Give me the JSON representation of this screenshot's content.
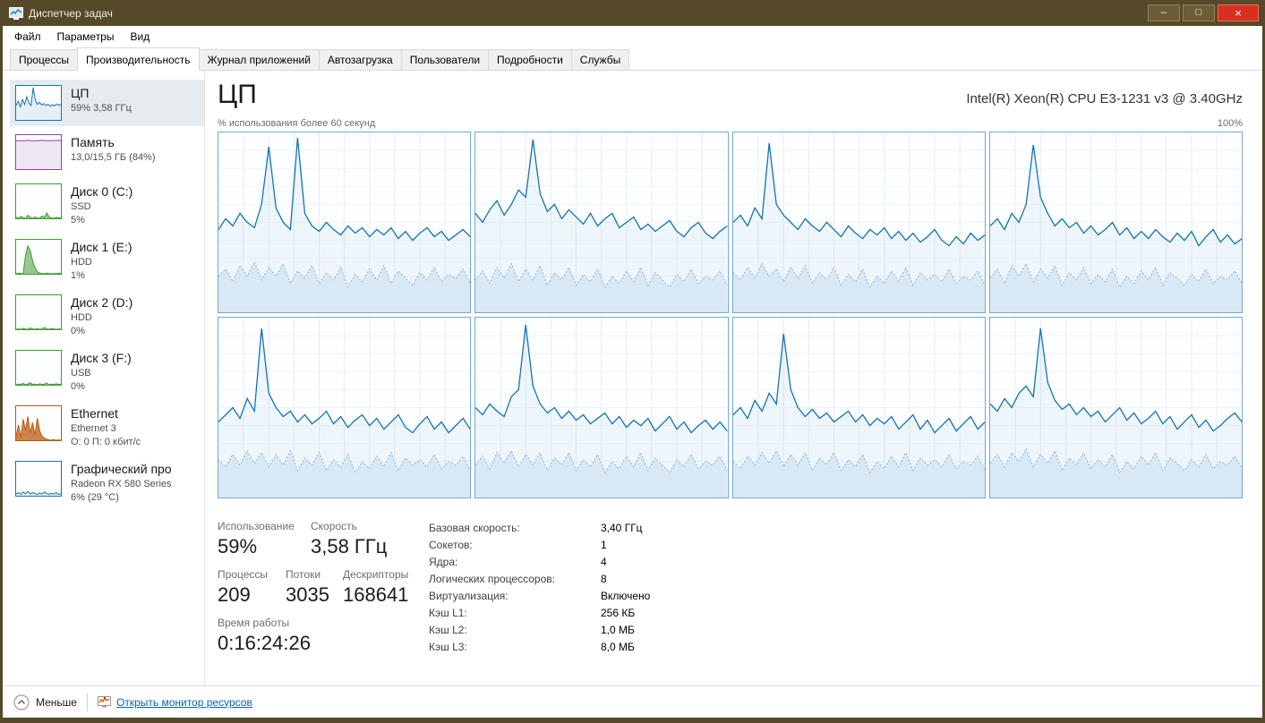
{
  "window": {
    "title": "Диспетчер задач",
    "controls": {
      "minimize": "–",
      "maximize": "□",
      "close": "×"
    }
  },
  "menu": {
    "items": [
      {
        "label": "Файл"
      },
      {
        "label": "Параметры"
      },
      {
        "label": "Вид"
      }
    ]
  },
  "tabs": [
    {
      "label": "Процессы"
    },
    {
      "label": "Производительность"
    },
    {
      "label": "Журнал приложений"
    },
    {
      "label": "Автозагрузка"
    },
    {
      "label": "Пользователи"
    },
    {
      "label": "Подробности"
    },
    {
      "label": "Службы"
    }
  ],
  "sidebar": {
    "items": [
      {
        "title": "ЦП",
        "lines": [
          "59%  3,58 ГГц"
        ],
        "color": "#1273b4",
        "fill": "rgba(18,115,180,0.10)",
        "series": [
          42,
          55,
          38,
          60,
          45,
          68,
          50,
          42,
          95,
          58,
          46,
          52,
          44,
          48,
          42,
          46,
          40,
          45,
          41,
          47,
          43,
          46
        ]
      },
      {
        "title": "Память",
        "lines": [
          "13,0/15,5 ГБ (84%)"
        ],
        "color": "#9341b3",
        "fill": "rgba(147,65,179,0.12)",
        "series": [
          83,
          84,
          84,
          83,
          84,
          85,
          84,
          84,
          83,
          84,
          84,
          85,
          84,
          84,
          83,
          84,
          84,
          84,
          85,
          84
        ]
      },
      {
        "title": "Диск 0 (C:)",
        "lines": [
          "SSD",
          "5%"
        ],
        "color": "#3f9c35",
        "fill": "rgba(63,156,53,0.55)",
        "series": [
          3,
          0,
          6,
          2,
          0,
          9,
          3,
          0,
          4,
          1,
          0,
          7,
          2,
          16,
          4,
          1,
          0,
          3,
          1,
          2
        ]
      },
      {
        "title": "Диск 1 (E:)",
        "lines": [
          "HDD",
          "1%"
        ],
        "color": "#3f9c35",
        "fill": "rgba(63,156,53,0.55)",
        "series": [
          0,
          2,
          1,
          0,
          55,
          82,
          68,
          38,
          18,
          6,
          2,
          1,
          0,
          2,
          1,
          0,
          1,
          0,
          2,
          1
        ]
      },
      {
        "title": "Диск 2 (D:)",
        "lines": [
          "HDD",
          "0%"
        ],
        "color": "#3f9c35",
        "fill": "rgba(63,156,53,0.55)",
        "series": [
          0,
          1,
          0,
          3,
          1,
          0,
          4,
          1,
          0,
          2,
          0,
          1,
          5,
          1,
          0,
          2,
          1,
          0,
          1,
          0
        ]
      },
      {
        "title": "Диск 3 (F:)",
        "lines": [
          "USB",
          "0%"
        ],
        "color": "#3f9c35",
        "fill": "rgba(63,156,53,0.55)",
        "series": [
          0,
          2,
          1,
          4,
          0,
          2,
          6,
          1,
          2,
          0,
          3,
          1,
          2,
          5,
          0,
          2,
          1,
          3,
          1,
          2
        ]
      },
      {
        "title": "Ethernet",
        "lines": [
          "Ethernet 3",
          "О: 0 П: 0 кбит/с"
        ],
        "color": "#bc5b12",
        "fill": "rgba(188,91,18,0.75)",
        "series": [
          12,
          45,
          8,
          62,
          30,
          70,
          22,
          52,
          15,
          65,
          28,
          12,
          6,
          3,
          1,
          0,
          2,
          0,
          1,
          0
        ]
      },
      {
        "title": "Графический про",
        "lines": [
          "Radeon RX 580 Series",
          "6%  (29 °C)"
        ],
        "color": "#1273b4",
        "fill": "rgba(18,115,180,0.10)",
        "series": [
          5,
          9,
          4,
          11,
          6,
          13,
          5,
          9,
          6,
          4,
          8,
          5,
          11,
          6,
          4,
          7,
          5,
          9,
          4,
          6
        ]
      }
    ]
  },
  "main": {
    "title": "ЦП",
    "cpu_name": "Intel(R) Xeon(R) CPU E3-1231 v3 @ 3.40GHz",
    "chart_caption": "% использования более 60 секунд",
    "chart_max": "100%",
    "stats_left": {
      "usage_label": "Использование",
      "usage_value": "59%",
      "speed_label": "Скорость",
      "speed_value": "3,58 ГГц",
      "processes_label": "Процессы",
      "processes_value": "209",
      "threads_label": "Потоки",
      "threads_value": "3035",
      "handles_label": "Дескрипторы",
      "handles_value": "168641",
      "uptime_label": "Время работы",
      "uptime_value": "0:16:24:26"
    },
    "stats_right": [
      {
        "label": "Базовая скорость:",
        "value": "3,40 ГГц"
      },
      {
        "label": "Сокетов:",
        "value": "1"
      },
      {
        "label": "Ядра:",
        "value": "4"
      },
      {
        "label": "Логических процессоров:",
        "value": "8"
      },
      {
        "label": "Виртуализация:",
        "value": "Включено"
      },
      {
        "label": "Кэш L1:",
        "value": "256 КБ"
      },
      {
        "label": "Кэш L2:",
        "value": "1,0 МБ"
      },
      {
        "label": "Кэш L3:",
        "value": "8,0 МБ"
      }
    ]
  },
  "footer": {
    "less_label": "Меньше",
    "resmon_label": "Открыть монитор ресурсов"
  },
  "chart_data": {
    "type": "line",
    "title": "ЦП — % использования более 60 секунд",
    "ylim": [
      0,
      100
    ],
    "theme": {
      "grid": "#e4eef7",
      "grid_h": "#edf4fa",
      "usage_line": "#1273b4",
      "usage_fill": "rgba(18,115,180,0.06)",
      "low_fill": "#d8e8f4",
      "low_line": "#8fb4d2"
    },
    "cores": [
      {
        "usage": [
          46,
          52,
          48,
          55,
          50,
          47,
          60,
          92,
          58,
          50,
          46,
          97,
          55,
          48,
          45,
          50,
          46,
          43,
          48,
          44,
          47,
          42,
          46,
          43,
          47,
          41,
          45,
          40,
          44,
          47,
          42,
          45,
          40,
          43,
          46,
          42
        ],
        "low": [
          20,
          24,
          17,
          26,
          20,
          28,
          18,
          25,
          20,
          27,
          16,
          23,
          19,
          26,
          16,
          22,
          18,
          25,
          14,
          21,
          17,
          24,
          18,
          26,
          16,
          23,
          19,
          15,
          22,
          18,
          25,
          17,
          21,
          19,
          24,
          16
        ]
      },
      {
        "usage": [
          55,
          50,
          57,
          62,
          54,
          60,
          68,
          64,
          96,
          66,
          56,
          60,
          52,
          57,
          53,
          49,
          55,
          48,
          52,
          55,
          47,
          50,
          53,
          46,
          49,
          45,
          48,
          51,
          45,
          42,
          47,
          50,
          44,
          41,
          45,
          48
        ],
        "low": [
          18,
          23,
          16,
          25,
          19,
          27,
          17,
          24,
          18,
          26,
          15,
          22,
          18,
          25,
          15,
          21,
          17,
          24,
          14,
          20,
          16,
          23,
          17,
          25,
          15,
          22,
          18,
          14,
          21,
          17,
          24,
          16,
          20,
          18,
          23,
          15
        ]
      },
      {
        "usage": [
          50,
          54,
          48,
          58,
          52,
          94,
          60,
          54,
          50,
          46,
          52,
          48,
          45,
          50,
          46,
          42,
          48,
          44,
          41,
          46,
          43,
          47,
          41,
          45,
          40,
          44,
          39,
          42,
          46,
          40,
          37,
          42,
          38,
          44,
          40,
          43
        ],
        "low": [
          22,
          18,
          25,
          19,
          27,
          20,
          24,
          17,
          25,
          19,
          26,
          16,
          22,
          18,
          25,
          15,
          21,
          17,
          24,
          14,
          20,
          16,
          23,
          17,
          25,
          15,
          22,
          18,
          21,
          17,
          24,
          16,
          20,
          18,
          23,
          15
        ]
      },
      {
        "usage": [
          48,
          52,
          46,
          55,
          50,
          60,
          93,
          64,
          55,
          48,
          52,
          47,
          50,
          44,
          48,
          43,
          46,
          50,
          43,
          47,
          41,
          45,
          41,
          46,
          42,
          39,
          44,
          40,
          45,
          37,
          42,
          46,
          39,
          43,
          38,
          41
        ],
        "low": [
          19,
          24,
          16,
          26,
          20,
          27,
          17,
          24,
          19,
          26,
          15,
          22,
          18,
          25,
          16,
          21,
          17,
          24,
          14,
          20,
          16,
          23,
          18,
          25,
          15,
          22,
          19,
          15,
          21,
          17,
          24,
          16,
          20,
          18,
          23,
          16
        ]
      },
      {
        "usage": [
          42,
          46,
          50,
          44,
          55,
          48,
          94,
          58,
          50,
          45,
          48,
          42,
          46,
          41,
          44,
          48,
          41,
          45,
          39,
          43,
          46,
          40,
          44,
          38,
          42,
          46,
          39,
          36,
          41,
          45,
          38,
          42,
          36,
          40,
          44,
          38
        ],
        "low": [
          21,
          17,
          24,
          18,
          26,
          19,
          25,
          17,
          24,
          18,
          26,
          15,
          22,
          18,
          25,
          15,
          21,
          17,
          24,
          14,
          20,
          16,
          23,
          17,
          25,
          15,
          22,
          18,
          21,
          17,
          24,
          16,
          20,
          18,
          23,
          15
        ]
      },
      {
        "usage": [
          50,
          46,
          52,
          48,
          45,
          56,
          60,
          96,
          62,
          52,
          47,
          50,
          44,
          48,
          43,
          46,
          41,
          44,
          47,
          41,
          45,
          39,
          43,
          40,
          44,
          37,
          41,
          45,
          38,
          42,
          36,
          40,
          43,
          38,
          42,
          37
        ],
        "low": [
          18,
          23,
          16,
          25,
          19,
          26,
          17,
          24,
          18,
          25,
          15,
          22,
          18,
          25,
          15,
          21,
          17,
          24,
          14,
          20,
          16,
          23,
          17,
          25,
          15,
          22,
          18,
          14,
          21,
          17,
          24,
          16,
          20,
          18,
          23,
          15
        ]
      },
      {
        "usage": [
          46,
          50,
          44,
          54,
          48,
          58,
          52,
          91,
          60,
          50,
          45,
          49,
          44,
          47,
          42,
          45,
          48,
          42,
          46,
          40,
          44,
          41,
          45,
          38,
          42,
          46,
          38,
          43,
          36,
          40,
          44,
          37,
          41,
          45,
          38,
          42
        ],
        "low": [
          20,
          16,
          23,
          18,
          25,
          19,
          26,
          17,
          24,
          18,
          25,
          15,
          22,
          18,
          25,
          15,
          21,
          17,
          24,
          14,
          20,
          16,
          23,
          17,
          25,
          15,
          22,
          18,
          21,
          17,
          24,
          16,
          20,
          18,
          23,
          15
        ]
      },
      {
        "usage": [
          52,
          48,
          55,
          50,
          58,
          62,
          56,
          94,
          64,
          54,
          49,
          52,
          46,
          50,
          45,
          48,
          42,
          46,
          50,
          43,
          47,
          41,
          44,
          48,
          41,
          45,
          38,
          42,
          46,
          39,
          43,
          37,
          40,
          44,
          47,
          42
        ],
        "low": [
          19,
          24,
          17,
          25,
          20,
          27,
          17,
          24,
          19,
          26,
          15,
          22,
          18,
          25,
          16,
          21,
          17,
          24,
          14,
          20,
          16,
          23,
          18,
          25,
          15,
          22,
          19,
          15,
          21,
          17,
          24,
          16,
          20,
          18,
          23,
          16
        ]
      }
    ]
  }
}
